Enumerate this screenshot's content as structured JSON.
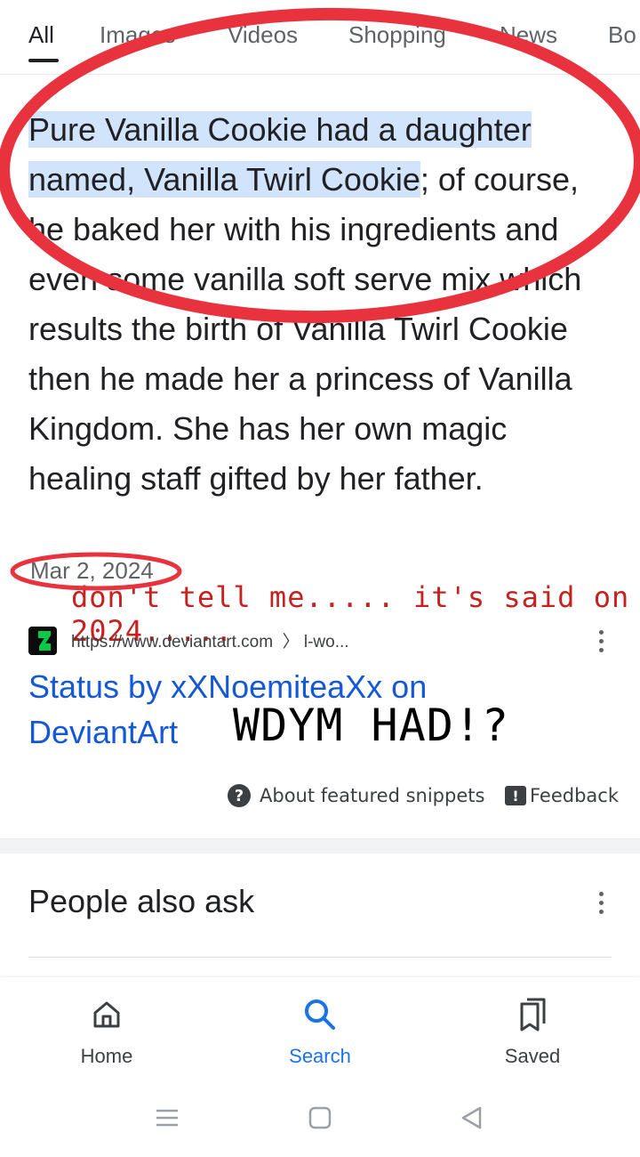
{
  "tabs": [
    {
      "label": "All",
      "active": true
    },
    {
      "label": "Images"
    },
    {
      "label": "Videos"
    },
    {
      "label": "Shopping"
    },
    {
      "label": "News"
    },
    {
      "label": "Bo"
    }
  ],
  "snippet": {
    "highlight_1": "Pure Vanilla Cookie had a daughter",
    "highlight_2": "named, Vanilla Twirl Cookie",
    "rest": "; of course, he baked her with his ingredients and even some vanilla soft serve mix which results the birth of Vanilla Twirl Cookie then he made her a princess of Vanilla Kingdom. She has her own magic healing staff gifted by her father.",
    "date": "Mar 2, 2024"
  },
  "annotations": {
    "red_note": "don't tell me..... it's said on 2024.....",
    "black_note": "WDYM HAD!?",
    "circle_color": "#e8333f"
  },
  "source": {
    "url": "https://www.deviantart.com",
    "path": "〉 l-wo...",
    "favicon": "deviantart-icon"
  },
  "result": {
    "title": "Status by xXNoemiteaXx on DeviantArt"
  },
  "snippet_footer": {
    "about": "About featured snippets",
    "feedback": "Feedback"
  },
  "paa": {
    "title": "People also ask"
  },
  "bottom_nav": {
    "home": "Home",
    "search": "Search",
    "saved": "Saved"
  },
  "colors": {
    "accent": "#1a73e8",
    "link": "#1558d6",
    "highlight": "#d2e3fc"
  }
}
